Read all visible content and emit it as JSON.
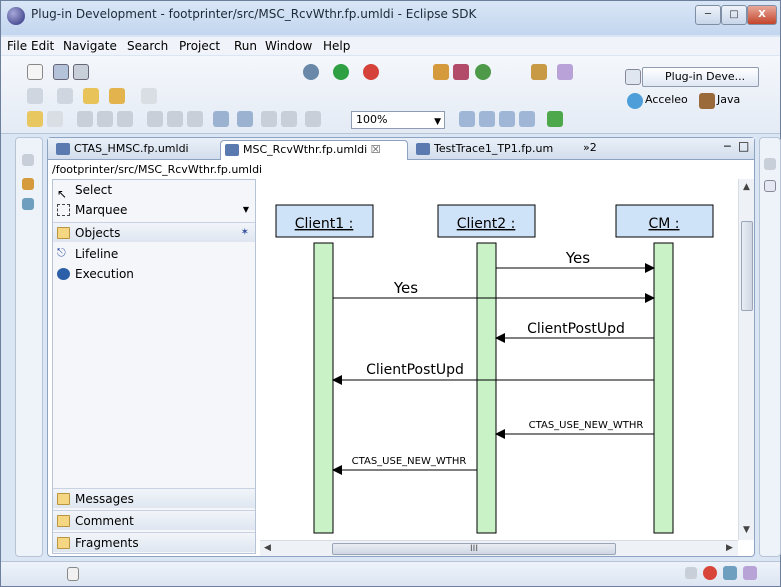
{
  "window": {
    "title": "Plug-in Development - footprinter/src/MSC_RcvWthr.fp.umldi - Eclipse SDK",
    "min_icon": "minimize-icon",
    "max_icon": "maximize-icon",
    "close_label": "X"
  },
  "menu": [
    "File",
    "Edit",
    "Navigate",
    "Search",
    "Project",
    "Run",
    "Window",
    "Help"
  ],
  "toolbar": {
    "zoom": "100%"
  },
  "perspectives": {
    "active": "Plug-in Deve...",
    "others": [
      "Acceleo",
      "Java"
    ]
  },
  "tabs": [
    {
      "label": "CTAS_HMSC.fp.umldi",
      "active": false
    },
    {
      "label": "MSC_RcvWthr.fp.umldi",
      "active": true,
      "close": "☒"
    },
    {
      "label": "TestTrace1_TP1.fp.um",
      "active": false
    }
  ],
  "tab_overflow": "»2",
  "breadcrumb": "/footprinter/src/MSC_RcvWthr.fp.umldi",
  "palette": {
    "select": "Select",
    "marquee": "Marquee",
    "drawers": {
      "objects": "Objects",
      "messages": "Messages",
      "comment": "Comment",
      "fragments": "Fragments"
    },
    "items": [
      "Lifeline",
      "Execution"
    ]
  },
  "diagram": {
    "lifelines": [
      "Client1 :",
      "Client2 :",
      "CM :"
    ],
    "messages": [
      {
        "label": "Yes",
        "from": 1,
        "to": 2
      },
      {
        "label": "Yes",
        "from": 0,
        "to": 2
      },
      {
        "label": "ClientPostUpd",
        "from": 2,
        "to": 1
      },
      {
        "label": "ClientPostUpd",
        "from": 2,
        "to": 0
      },
      {
        "label": "CTAS_USE_NEW_WTHR",
        "from": 2,
        "to": 1
      },
      {
        "label": "CTAS_USE_NEW_WTHR",
        "from": 1,
        "to": 0
      }
    ],
    "colors": {
      "lifeline_head": "#cfe3f8",
      "lifeline_bar": "#c9f2c7",
      "line": "#000000"
    }
  },
  "hscroll_label": "III"
}
